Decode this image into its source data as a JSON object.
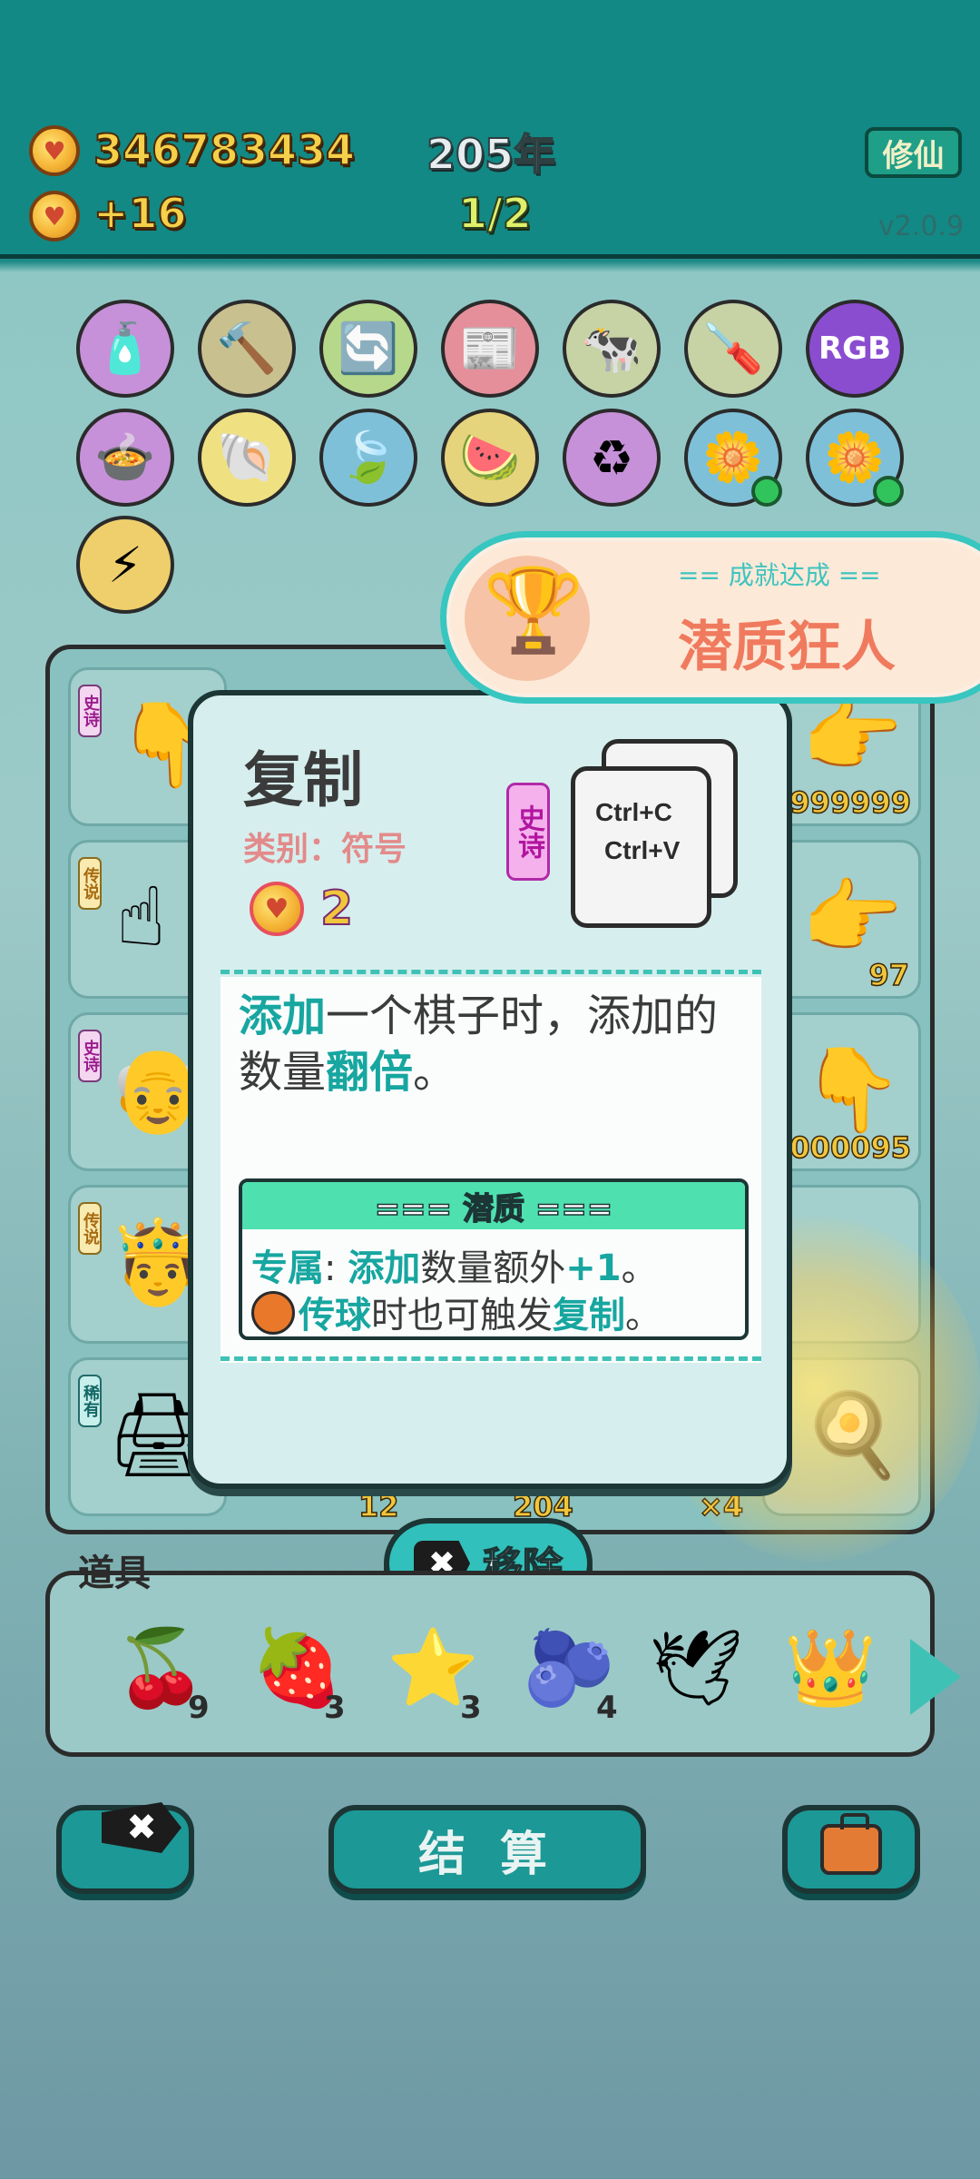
{
  "hud": {
    "coins": "346783434",
    "income": "+16",
    "year": "205年",
    "round": "1/2",
    "cultivate_button": "修仙",
    "version": "v2.0.9"
  },
  "popup": {
    "title": "复制",
    "category": "类别：符号",
    "cost": "2",
    "rarity": "史诗",
    "card_line1": "Ctrl+C",
    "card_line2": "Ctrl+V",
    "desc_hl1": "添加",
    "desc_part1": "一个棋子时，添加的数量",
    "desc_hl2": "翻倍",
    "desc_part2": "。",
    "potential_title": "=== 潜质 ===",
    "pot_label": "专属",
    "pot_colon": ":",
    "pot_hl1": "添加",
    "pot_text1": "数量额外",
    "pot_hl2": "+1",
    "pot_end1": "。",
    "pot_hl3": "传球",
    "pot_text2": "时也可触发",
    "pot_hl4": "复制",
    "pot_end2": "。"
  },
  "achievement": {
    "label": "== 成就达成 ==",
    "name": "潜质狂人"
  },
  "board": {
    "counts": [
      "999999",
      "97",
      "000095",
      "12",
      "204",
      "×4"
    ],
    "tags": [
      "史诗",
      "传说",
      "史诗",
      "传说",
      "稀有"
    ]
  },
  "remove_button": {
    "icon": "✖",
    "label": "移除"
  },
  "props": {
    "label": "道具",
    "items": [
      {
        "icon": "lychee-icon",
        "count": "9"
      },
      {
        "icon": "strawberry-icon",
        "count": "3"
      },
      {
        "icon": "star-fruit-icon",
        "count": "3"
      },
      {
        "icon": "blueberry-icon",
        "count": "4"
      },
      {
        "icon": "pigeon-icon",
        "count": ""
      },
      {
        "icon": "crown-icon",
        "count": ""
      }
    ]
  },
  "bottom": {
    "settle_label": "结 算",
    "discard_icon": "✖"
  },
  "colors": {
    "header": "#128985",
    "accent": "#17a6a0",
    "coin": "#f5d04a"
  }
}
